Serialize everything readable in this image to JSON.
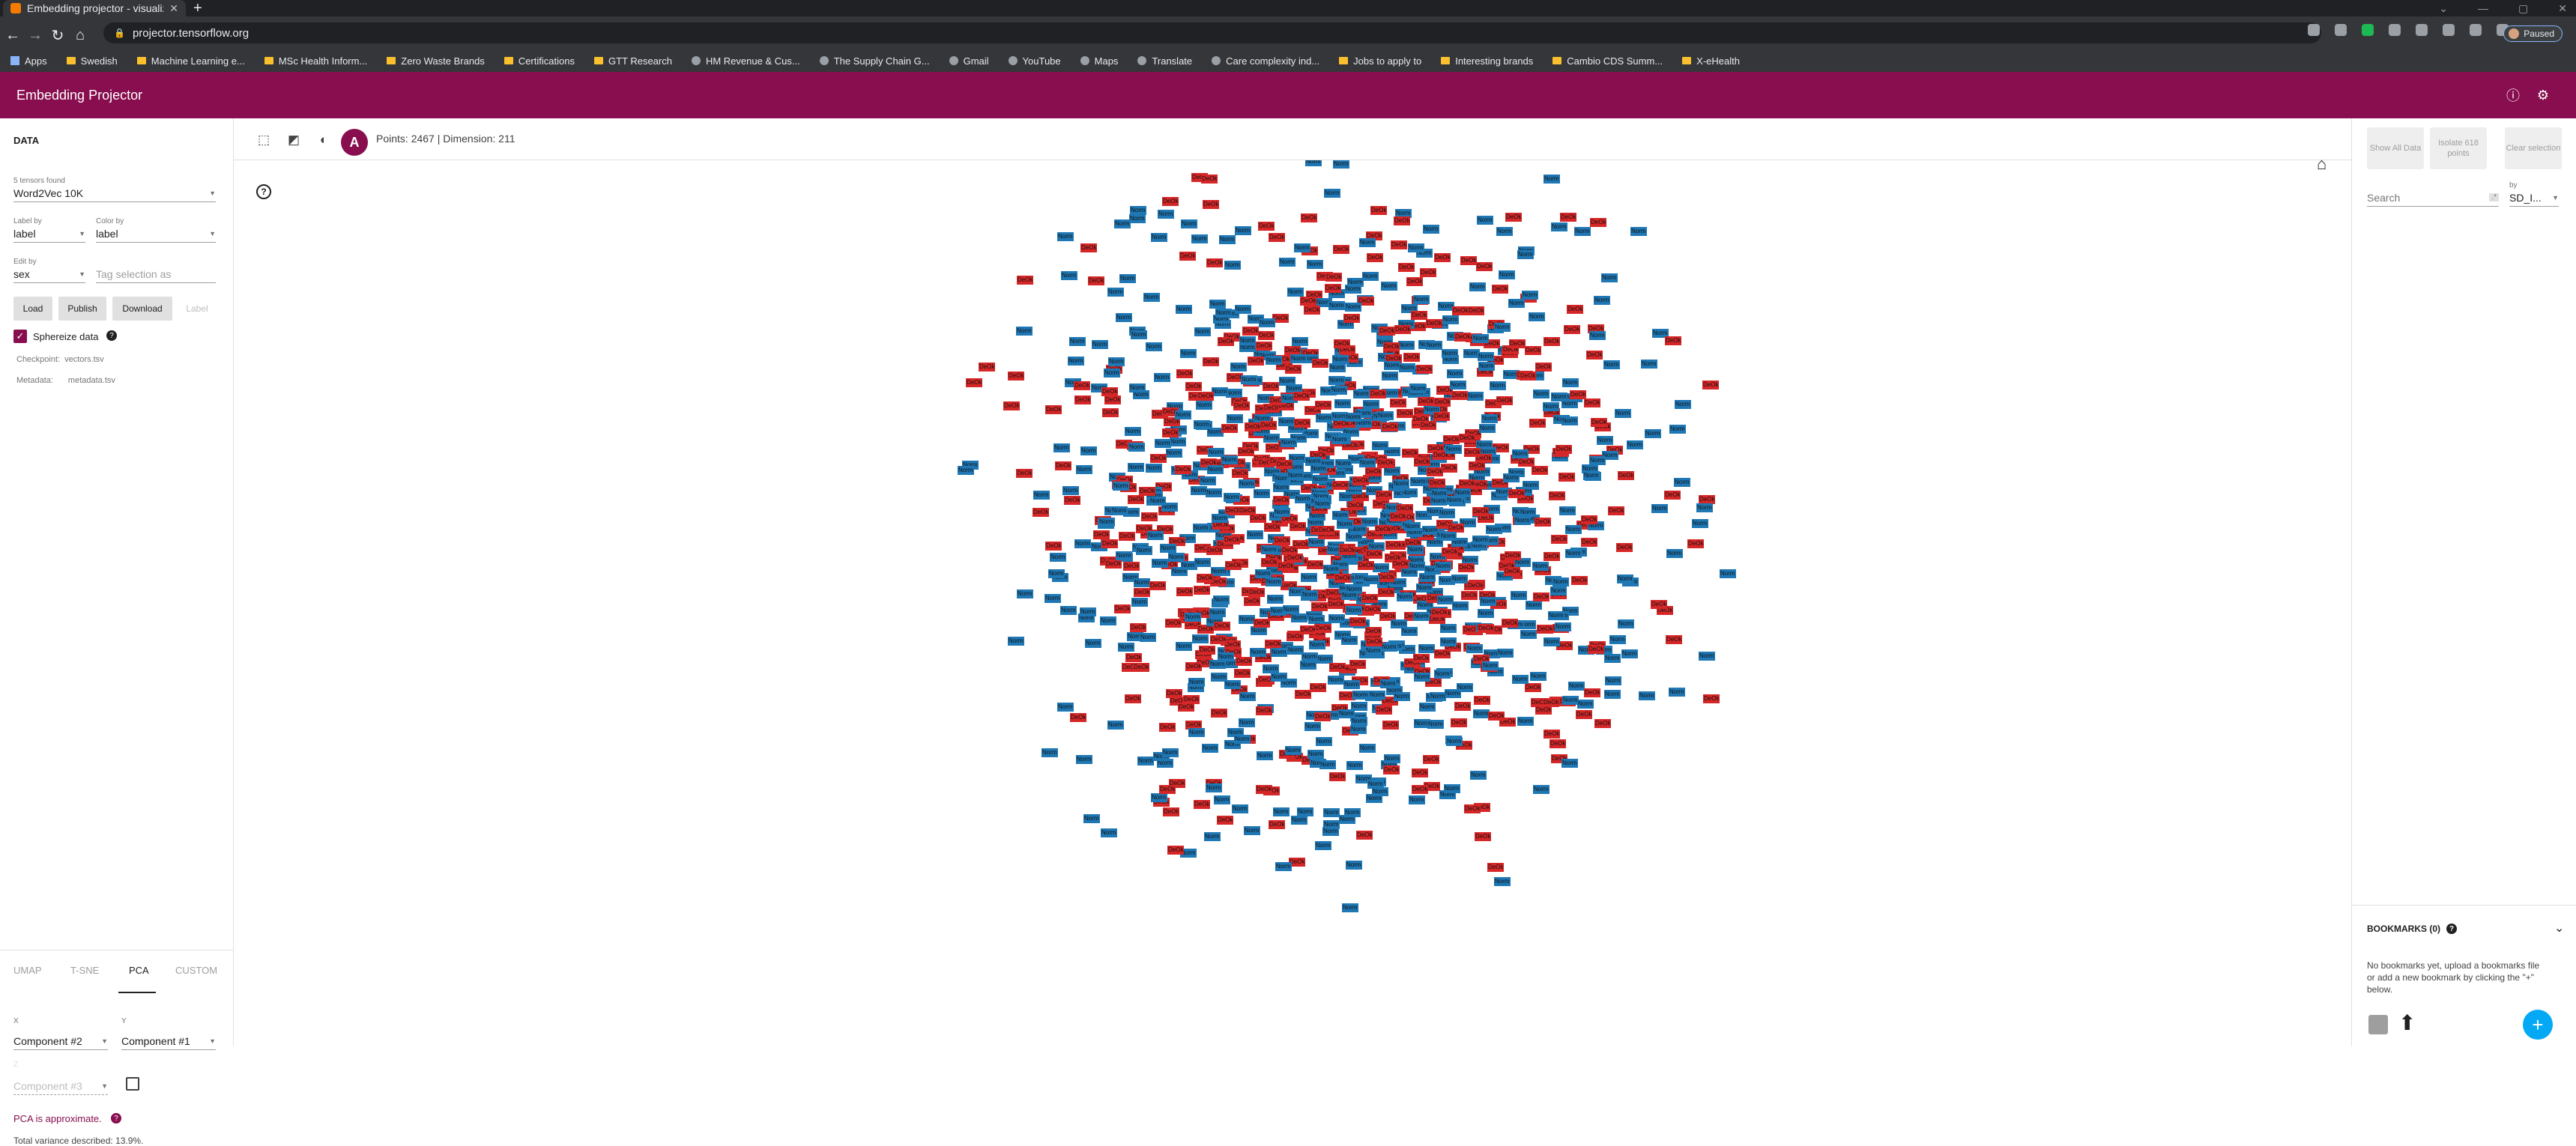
{
  "browser": {
    "tab_title": "Embedding projector - visualiz",
    "url": "projector.tensorflow.org",
    "profile_label": "Paused",
    "bookmarks": [
      "Apps",
      "Swedish",
      "Machine Learning e...",
      "MSc Health Inform...",
      "Zero Waste Brands",
      "Certifications",
      "GTT Research",
      "HM Revenue & Cus...",
      "The Supply Chain G...",
      "Gmail",
      "YouTube",
      "Maps",
      "Translate",
      "Care complexity ind...",
      "Jobs to apply to",
      "Interesting brands",
      "Cambio CDS Summ...",
      "X-eHealth"
    ]
  },
  "app": {
    "title": "Embedding Projector"
  },
  "data_panel": {
    "heading": "DATA",
    "tensors_found": "5 tensors found",
    "tensor": "Word2Vec 10K",
    "label_by_label": "Label by",
    "label_by": "label",
    "color_by_label": "Color by",
    "color_by": "label",
    "edit_by_label": "Edit by",
    "edit_by": "sex",
    "tag_placeholder": "Tag selection as",
    "load": "Load",
    "publish": "Publish",
    "download": "Download",
    "label_btn": "Label",
    "sphereize": "Sphereize data",
    "checkpoint_label": "Checkpoint:",
    "checkpoint": "vectors.tsv",
    "metadata_label": "Metadata:",
    "metadata": "metadata.tsv"
  },
  "projection": {
    "tabs": [
      "UMAP",
      "T-SNE",
      "PCA",
      "CUSTOM"
    ],
    "active_tab": "PCA",
    "x_label": "X",
    "x_component": "Component #2",
    "y_label": "Y",
    "y_component": "Component #1",
    "z_label": "Z",
    "z_component": "Component #3",
    "approx_note": "PCA is approximate.",
    "variance": "Total variance described: 13.9%."
  },
  "center": {
    "points_info": "Points: 2467 | Dimension: 211",
    "label_mode_glyph": "A",
    "point_label_male": "Norm",
    "point_label_female": "DeOk",
    "color_male": "#1f77b4",
    "color_female": "#d62728"
  },
  "inspector": {
    "show_all": "Show All Data",
    "isolate": "Isolate 618 points",
    "clear": "Clear selection",
    "by_label": "by",
    "search_placeholder": "Search",
    "search_by": "SD_I...",
    "bookmarks_title": "BOOKMARKS (0)",
    "bookmarks_empty": "No bookmarks yet, upload a bookmarks file or add a new bookmark by clicking the \"+\" below."
  },
  "colors": {
    "accent": "#880e4f",
    "fab": "#03a9f4"
  }
}
